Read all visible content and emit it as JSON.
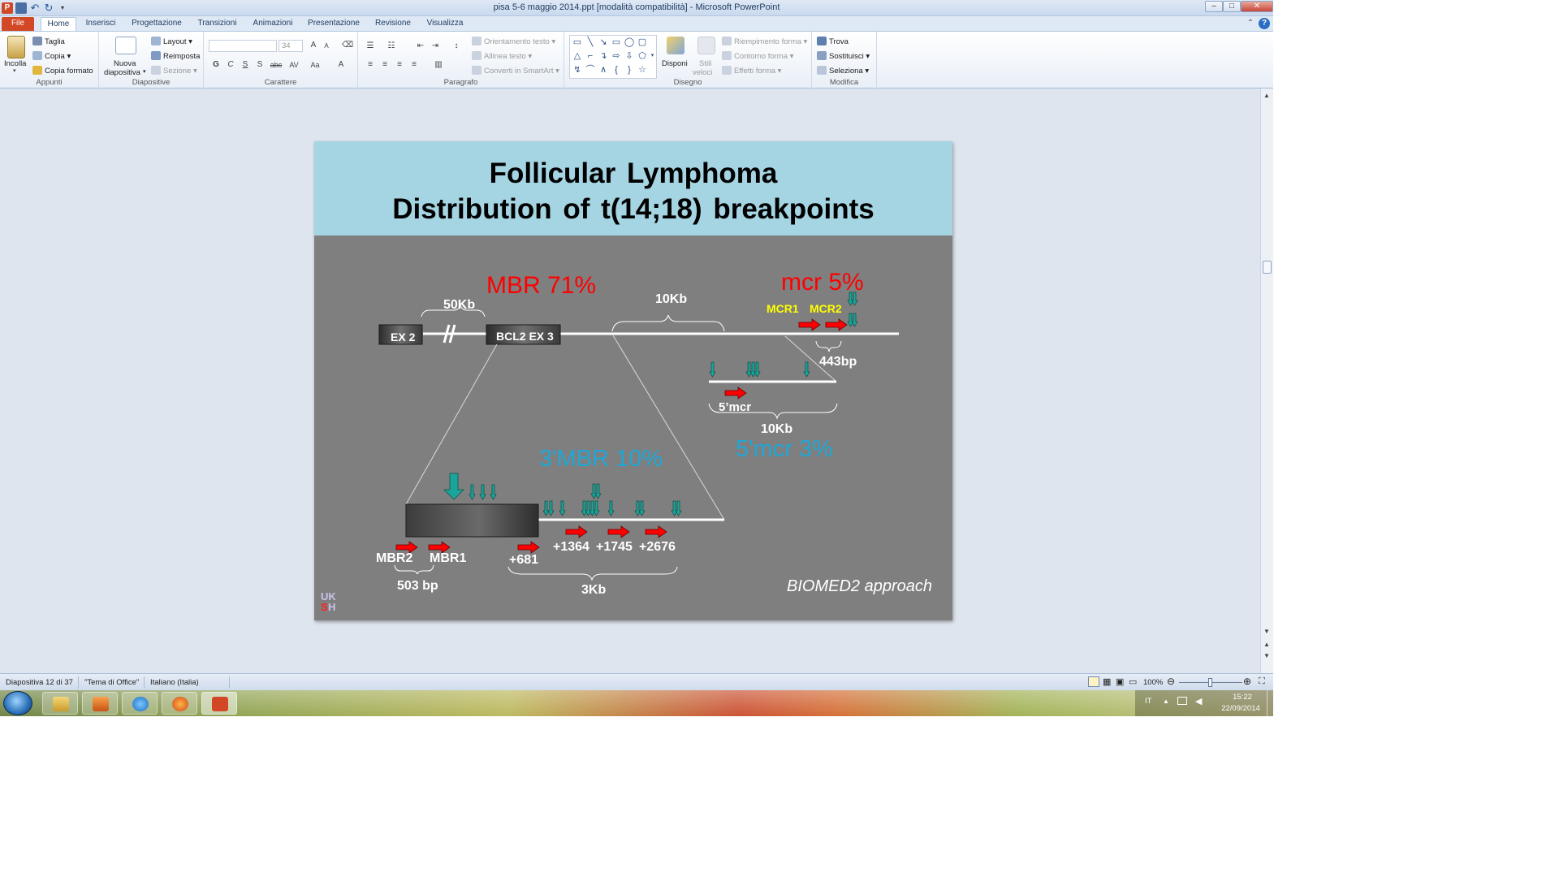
{
  "window": {
    "title": "pisa 5-6 maggio 2014.ppt [modalità compatibilità]  -  Microsoft PowerPoint",
    "app_icon": "P",
    "minimize": "–",
    "maximize": "□",
    "close": "✕",
    "help": "?"
  },
  "tabs": [
    "File",
    "Home",
    "Inserisci",
    "Progettazione",
    "Transizioni",
    "Animazioni",
    "Presentazione",
    "Revisione",
    "Visualizza"
  ],
  "ribbon": {
    "appunti": {
      "label": "Appunti",
      "paste": "Incolla",
      "cut": "Taglia",
      "copy": "Copia",
      "format_painter": "Copia formato"
    },
    "diapositive": {
      "label": "Diapositive",
      "new_slide_1": "Nuova",
      "new_slide_2": "diapositiva",
      "layout": "Layout",
      "reset": "Reimposta",
      "section": "Sezione"
    },
    "carattere": {
      "label": "Carattere",
      "font_size": "34",
      "bold": "G",
      "italic": "C",
      "underline": "S",
      "shadow": "S",
      "strike": "abc",
      "spacing": "AV",
      "case": "Aa",
      "color": "A",
      "grow": "A",
      "shrink": "A"
    },
    "paragrafo": {
      "label": "Paragrafo",
      "text_direction": "Orientamento testo",
      "align_text": "Allinea testo",
      "smartart": "Converti in SmartArt"
    },
    "disegno": {
      "label": "Disegno",
      "arrange": "Disponi",
      "quick_styles_1": "Stili",
      "quick_styles_2": "veloci",
      "shape_fill": "Riempimento forma",
      "shape_outline": "Contorno forma",
      "shape_effects": "Effetti forma"
    },
    "modifica": {
      "label": "Modifica",
      "find": "Trova",
      "replace": "Sostituisci",
      "select": "Seleziona"
    }
  },
  "slide": {
    "title_line1": "Follicular  Lymphoma",
    "title_line2": "Distribution  of  t(14;18)  breakpoints",
    "mbr_pct": "MBR 71%",
    "mcr_pct": "mcr 5%",
    "mbr3_pct": "3'MBR 10%",
    "mcr5_pct": "5'mcr 3%",
    "ex2": "EX 2",
    "bcl2ex3": "BCL2 EX 3",
    "kb50": "50Kb",
    "kb10_top": "10Kb",
    "mcr1": "MCR1",
    "mcr2": "MCR2",
    "bp443": "443bp",
    "mcr5_label": "5’mcr",
    "kb10_bottom": "10Kb",
    "mbr2": "MBR2",
    "mbr1": "MBR1",
    "bp503": "503 bp",
    "p681": "+681",
    "p1364": "+1364",
    "p1745": "+1745",
    "p2676": "+2676",
    "kb3": "3Kb",
    "biomed": "BIOMED2 approach",
    "logo_uk": "UK",
    "logo_s": "S",
    "logo_h": "H",
    "colors": {
      "header": "#a5d4e2",
      "background": "#7f7f7f",
      "red": "#ff0000",
      "blue": "#1fa7d6",
      "yellow": "#ffff00",
      "teal": "#1aa59a"
    }
  },
  "status": {
    "slide": "Diapositiva 12 di 37",
    "theme": "\"Tema di Office\"",
    "language": "Italiano (Italia)",
    "zoom": "100%"
  },
  "tray": {
    "lang": "IT",
    "time": "15:22",
    "date": "22/09/2014"
  }
}
